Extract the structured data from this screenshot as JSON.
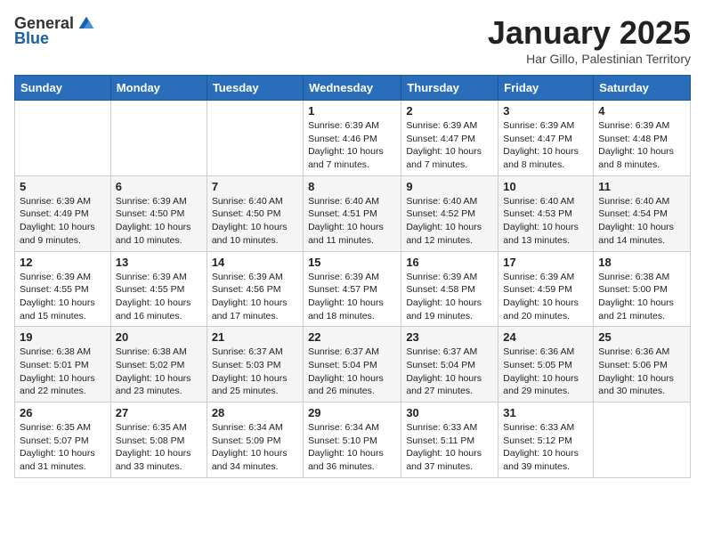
{
  "header": {
    "logo_general": "General",
    "logo_blue": "Blue",
    "main_title": "January 2025",
    "subtitle": "Har Gillo, Palestinian Territory"
  },
  "days_of_week": [
    "Sunday",
    "Monday",
    "Tuesday",
    "Wednesday",
    "Thursday",
    "Friday",
    "Saturday"
  ],
  "weeks": [
    [
      {
        "day": "",
        "info": ""
      },
      {
        "day": "",
        "info": ""
      },
      {
        "day": "",
        "info": ""
      },
      {
        "day": "1",
        "info": "Sunrise: 6:39 AM\nSunset: 4:46 PM\nDaylight: 10 hours\nand 7 minutes."
      },
      {
        "day": "2",
        "info": "Sunrise: 6:39 AM\nSunset: 4:47 PM\nDaylight: 10 hours\nand 7 minutes."
      },
      {
        "day": "3",
        "info": "Sunrise: 6:39 AM\nSunset: 4:47 PM\nDaylight: 10 hours\nand 8 minutes."
      },
      {
        "day": "4",
        "info": "Sunrise: 6:39 AM\nSunset: 4:48 PM\nDaylight: 10 hours\nand 8 minutes."
      }
    ],
    [
      {
        "day": "5",
        "info": "Sunrise: 6:39 AM\nSunset: 4:49 PM\nDaylight: 10 hours\nand 9 minutes."
      },
      {
        "day": "6",
        "info": "Sunrise: 6:39 AM\nSunset: 4:50 PM\nDaylight: 10 hours\nand 10 minutes."
      },
      {
        "day": "7",
        "info": "Sunrise: 6:40 AM\nSunset: 4:50 PM\nDaylight: 10 hours\nand 10 minutes."
      },
      {
        "day": "8",
        "info": "Sunrise: 6:40 AM\nSunset: 4:51 PM\nDaylight: 10 hours\nand 11 minutes."
      },
      {
        "day": "9",
        "info": "Sunrise: 6:40 AM\nSunset: 4:52 PM\nDaylight: 10 hours\nand 12 minutes."
      },
      {
        "day": "10",
        "info": "Sunrise: 6:40 AM\nSunset: 4:53 PM\nDaylight: 10 hours\nand 13 minutes."
      },
      {
        "day": "11",
        "info": "Sunrise: 6:40 AM\nSunset: 4:54 PM\nDaylight: 10 hours\nand 14 minutes."
      }
    ],
    [
      {
        "day": "12",
        "info": "Sunrise: 6:39 AM\nSunset: 4:55 PM\nDaylight: 10 hours\nand 15 minutes."
      },
      {
        "day": "13",
        "info": "Sunrise: 6:39 AM\nSunset: 4:55 PM\nDaylight: 10 hours\nand 16 minutes."
      },
      {
        "day": "14",
        "info": "Sunrise: 6:39 AM\nSunset: 4:56 PM\nDaylight: 10 hours\nand 17 minutes."
      },
      {
        "day": "15",
        "info": "Sunrise: 6:39 AM\nSunset: 4:57 PM\nDaylight: 10 hours\nand 18 minutes."
      },
      {
        "day": "16",
        "info": "Sunrise: 6:39 AM\nSunset: 4:58 PM\nDaylight: 10 hours\nand 19 minutes."
      },
      {
        "day": "17",
        "info": "Sunrise: 6:39 AM\nSunset: 4:59 PM\nDaylight: 10 hours\nand 20 minutes."
      },
      {
        "day": "18",
        "info": "Sunrise: 6:38 AM\nSunset: 5:00 PM\nDaylight: 10 hours\nand 21 minutes."
      }
    ],
    [
      {
        "day": "19",
        "info": "Sunrise: 6:38 AM\nSunset: 5:01 PM\nDaylight: 10 hours\nand 22 minutes."
      },
      {
        "day": "20",
        "info": "Sunrise: 6:38 AM\nSunset: 5:02 PM\nDaylight: 10 hours\nand 23 minutes."
      },
      {
        "day": "21",
        "info": "Sunrise: 6:37 AM\nSunset: 5:03 PM\nDaylight: 10 hours\nand 25 minutes."
      },
      {
        "day": "22",
        "info": "Sunrise: 6:37 AM\nSunset: 5:04 PM\nDaylight: 10 hours\nand 26 minutes."
      },
      {
        "day": "23",
        "info": "Sunrise: 6:37 AM\nSunset: 5:04 PM\nDaylight: 10 hours\nand 27 minutes."
      },
      {
        "day": "24",
        "info": "Sunrise: 6:36 AM\nSunset: 5:05 PM\nDaylight: 10 hours\nand 29 minutes."
      },
      {
        "day": "25",
        "info": "Sunrise: 6:36 AM\nSunset: 5:06 PM\nDaylight: 10 hours\nand 30 minutes."
      }
    ],
    [
      {
        "day": "26",
        "info": "Sunrise: 6:35 AM\nSunset: 5:07 PM\nDaylight: 10 hours\nand 31 minutes."
      },
      {
        "day": "27",
        "info": "Sunrise: 6:35 AM\nSunset: 5:08 PM\nDaylight: 10 hours\nand 33 minutes."
      },
      {
        "day": "28",
        "info": "Sunrise: 6:34 AM\nSunset: 5:09 PM\nDaylight: 10 hours\nand 34 minutes."
      },
      {
        "day": "29",
        "info": "Sunrise: 6:34 AM\nSunset: 5:10 PM\nDaylight: 10 hours\nand 36 minutes."
      },
      {
        "day": "30",
        "info": "Sunrise: 6:33 AM\nSunset: 5:11 PM\nDaylight: 10 hours\nand 37 minutes."
      },
      {
        "day": "31",
        "info": "Sunrise: 6:33 AM\nSunset: 5:12 PM\nDaylight: 10 hours\nand 39 minutes."
      },
      {
        "day": "",
        "info": ""
      }
    ]
  ]
}
